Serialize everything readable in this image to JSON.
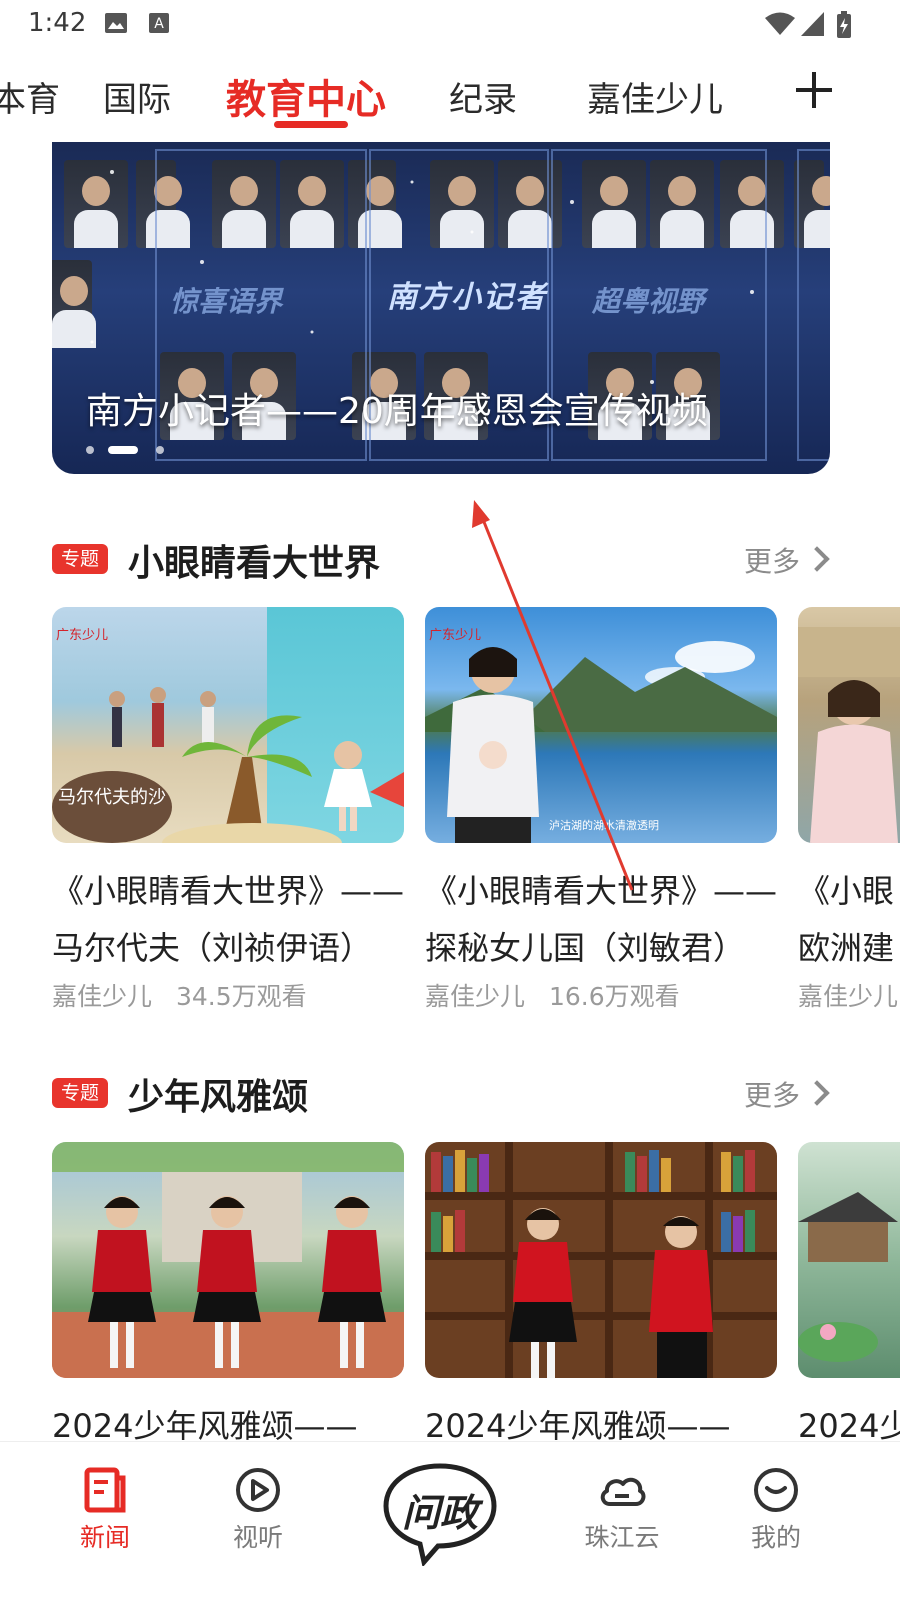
{
  "status_bar": {
    "time": "1:42"
  },
  "tabs": [
    {
      "label": "体育",
      "visible": "体育"
    },
    {
      "label": "国际"
    },
    {
      "label": "教育中心",
      "active": true
    },
    {
      "label": "纪录"
    },
    {
      "label": "嘉佳少儿"
    }
  ],
  "tab_cut_label": "本育",
  "banner": {
    "caption": "南方小记者——20周年感恩会宣传视频",
    "center_logo": "南方小记者",
    "side_left": "惊喜语界",
    "side_right": "超粤视野",
    "active_dot": 2,
    "dot_count": 3
  },
  "sections": [
    {
      "badge": "专题",
      "title": "小眼睛看大世界",
      "more": "更多",
      "cards": [
        {
          "title": "《小眼睛看大世界》——\n马尔代夫（刘祯伊语）",
          "channel": "嘉佳少儿",
          "views": "34.5万观看"
        },
        {
          "title": "《小眼睛看大世界》——\n探秘女儿国（刘敏君）",
          "channel": "嘉佳少儿",
          "views": "16.6万观看"
        },
        {
          "title": "《小眼\n欧洲建",
          "channel": "嘉佳少儿",
          "views": ""
        }
      ]
    },
    {
      "badge": "专题",
      "title": "少年风雅颂",
      "more": "更多",
      "cards": [
        {
          "title": "2024少年风雅颂——",
          "channel": "",
          "views": ""
        },
        {
          "title": "2024少年风雅颂——",
          "channel": "",
          "views": ""
        },
        {
          "title": "2024少",
          "channel": "",
          "views": ""
        }
      ]
    }
  ],
  "thumb_texts": {
    "maldives_caption": "马尔代夫的沙",
    "lake_caption": "泸沽湖的湖水清澈透明"
  },
  "bottom_nav": [
    {
      "label": "新闻",
      "icon": "news-icon",
      "active": true
    },
    {
      "label": "视听",
      "icon": "play-icon"
    },
    {
      "label": "问政",
      "icon": "wenzheng-bubble-icon"
    },
    {
      "label": "珠江云",
      "icon": "cloud-icon"
    },
    {
      "label": "我的",
      "icon": "profile-icon"
    }
  ],
  "colors": {
    "accent": "#e62b25",
    "badge": "#e8342c",
    "gesture_arrow": "#e03a2f"
  }
}
